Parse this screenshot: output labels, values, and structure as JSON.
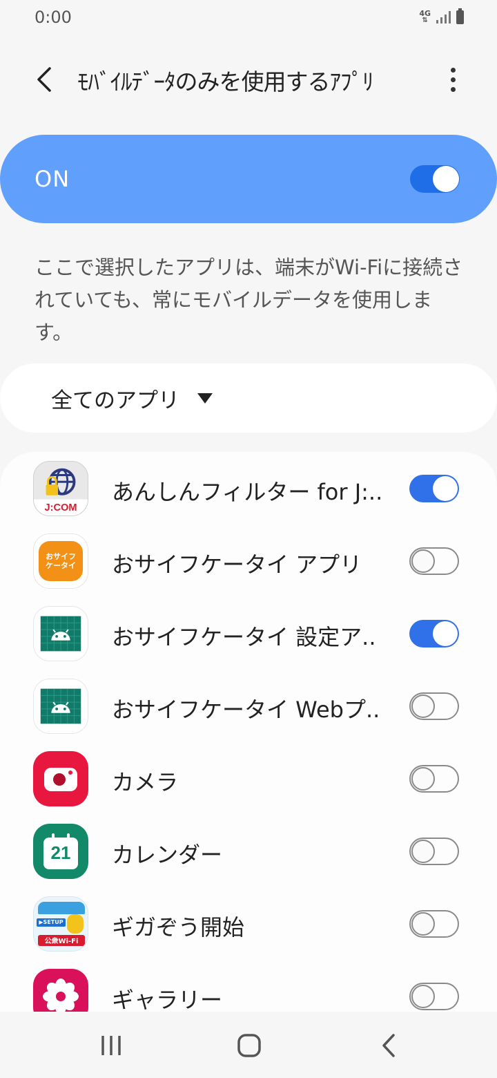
{
  "status_bar": {
    "time": "0:00",
    "network": "4G"
  },
  "app_bar": {
    "title": "ﾓﾊﾞｲﾙﾃﾞｰﾀのみを使用するｱﾌﾟﾘ"
  },
  "master_switch": {
    "label": "ON",
    "state": "on"
  },
  "description": "ここで選択したアプリは、端末がWi-Fiに接続されていても、常にモバイルデータを使用します。",
  "filter": {
    "selected": "全てのアプリ"
  },
  "apps": [
    {
      "label": "あんしんフィルター for J:COM",
      "display": "あんしんフィルター for J:..",
      "icon": "jcom-globe-lock-icon",
      "enabled": true
    },
    {
      "label": "おサイフケータイ アプリ",
      "display": "おサイフケータイ アプリ",
      "icon": "osaifu-keitai-icon",
      "enabled": false,
      "icon_text": "おサイフ ケータイ"
    },
    {
      "label": "おサイフケータイ 設定アプリ",
      "display": "おサイフケータイ 設定ア..",
      "icon": "android-icon",
      "enabled": true
    },
    {
      "label": "おサイフケータイ Webプラグイン",
      "display": "おサイフケータイ Webプ..",
      "icon": "android-icon",
      "enabled": false
    },
    {
      "label": "カメラ",
      "display": "カメラ",
      "icon": "camera-icon",
      "enabled": false
    },
    {
      "label": "カレンダー",
      "display": "カレンダー",
      "icon": "calendar-icon",
      "enabled": false,
      "icon_text": "21"
    },
    {
      "label": "ギガぞう開始",
      "display": "ギガぞう開始",
      "icon": "gigazo-icon",
      "enabled": false,
      "icon_text": "公衆Wi-Fi",
      "icon_text2": "▶SETUP"
    },
    {
      "label": "ギャラリー",
      "display": "ギャラリー",
      "icon": "gallery-flower-icon",
      "enabled": false
    }
  ],
  "colors": {
    "accent": "#60a0fc",
    "toggle_on": "#3070e8",
    "camera": "#e8173f",
    "calendar": "#128a6a",
    "gallery": "#d9115a",
    "osaifu": "#f39016",
    "android_bg": "#127a68"
  }
}
